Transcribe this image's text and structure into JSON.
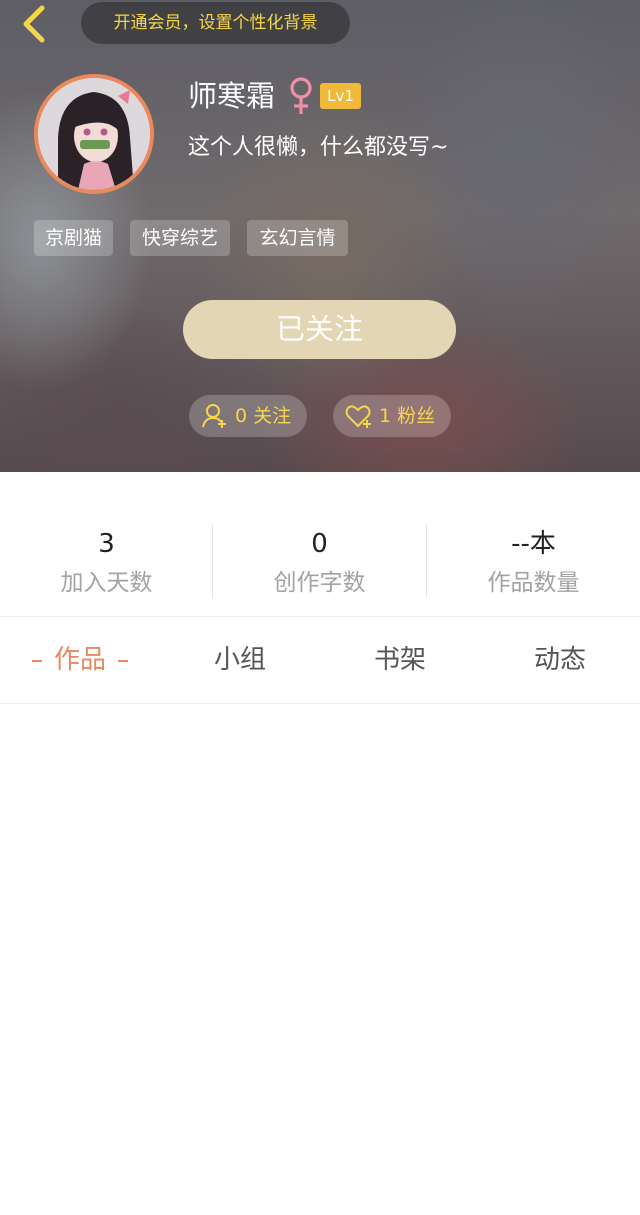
{
  "header": {
    "vip_banner": "开通会员，设置个性化背景",
    "username": "师寒霜",
    "gender_symbol": "♀",
    "level": "Lv1",
    "signature": "这个人很懒，什么都没写~",
    "tags": [
      "京剧猫",
      "快穿综艺",
      "玄幻言情"
    ],
    "follow_button": "已关注",
    "following": "0 关注",
    "fans": "1 粉丝"
  },
  "stats": [
    {
      "value": "3",
      "label": "加入天数"
    },
    {
      "value": "0",
      "label": "创作字数"
    },
    {
      "value": "--本",
      "label": "作品数量"
    }
  ],
  "tabs": [
    "作品",
    "小组",
    "书架",
    "动态"
  ],
  "colors": {
    "accent": "#e9895c",
    "vip_text": "#f6d64a",
    "level_badge": "#f0b93a",
    "follow_button": "#e3d6b4",
    "gender": "#f08fa5"
  }
}
